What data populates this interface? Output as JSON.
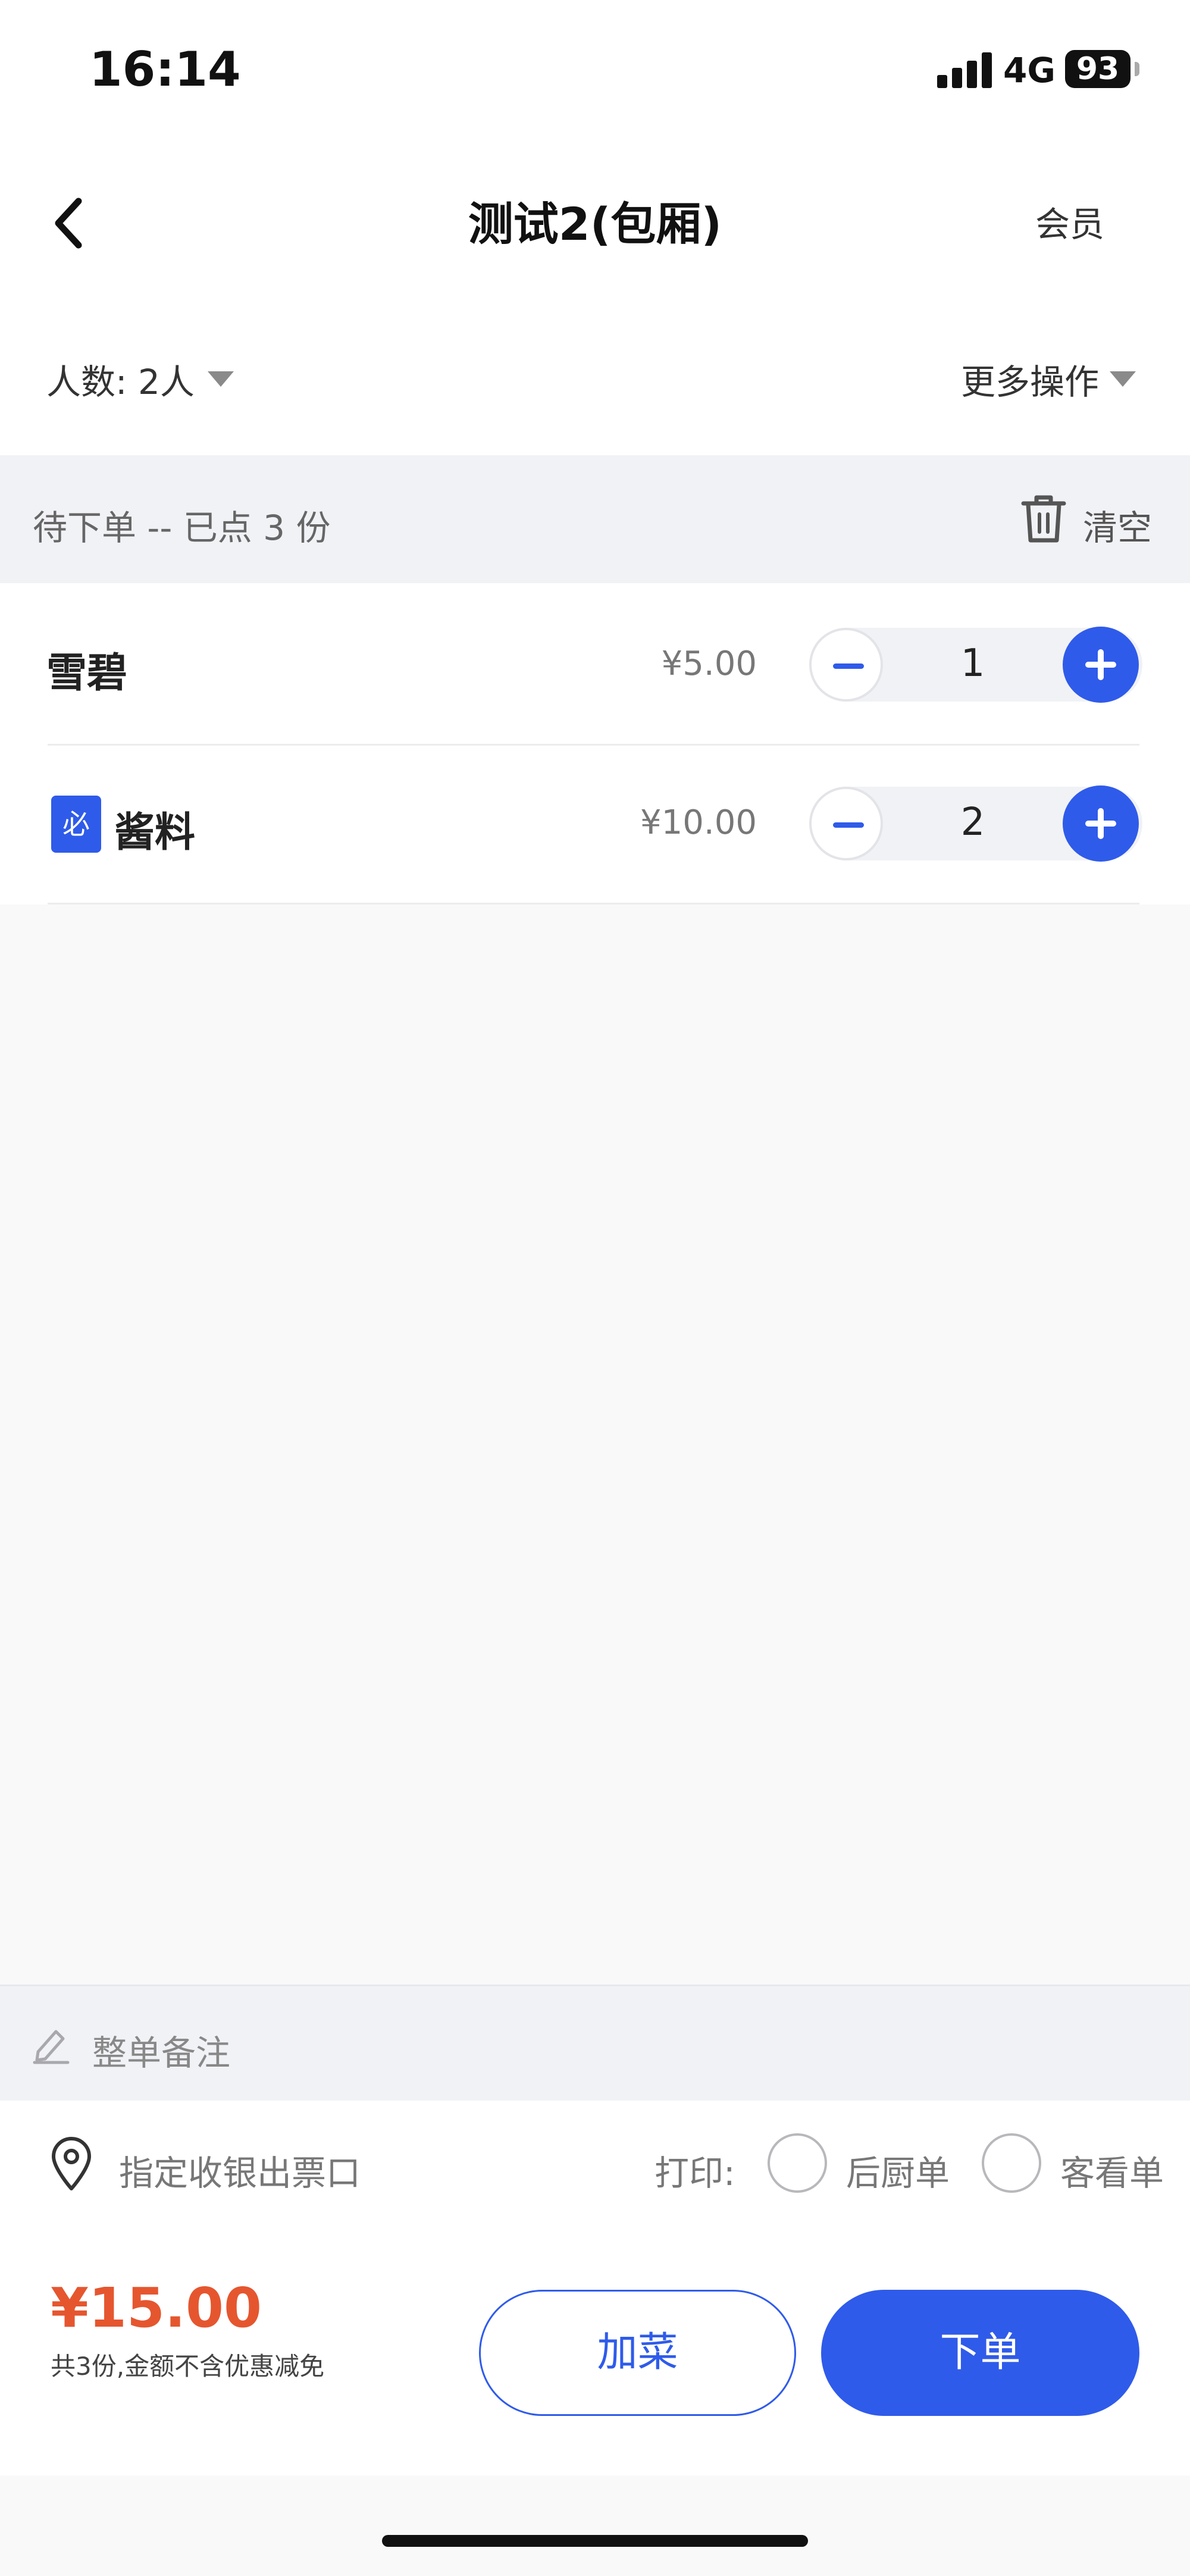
{
  "status_bar": {
    "time": "16:14",
    "network": "4G",
    "battery": "93"
  },
  "nav": {
    "title": "测试2(包厢)",
    "member": "会员"
  },
  "people": {
    "label": "人数: 2人",
    "more_actions": "更多操作"
  },
  "pending": {
    "summary": "待下单 -- 已点 3 份",
    "clear": "清空"
  },
  "items": [
    {
      "name": "雪碧",
      "price": "¥5.00",
      "qty": "1",
      "badge": ""
    },
    {
      "name": "酱料",
      "price": "¥10.00",
      "qty": "2",
      "badge": "必"
    }
  ],
  "remark": {
    "placeholder": "整单备注"
  },
  "cashier": {
    "label": "指定收银出票口"
  },
  "print": {
    "label": "打印:",
    "options": [
      "后厨单",
      "客看单"
    ]
  },
  "footer": {
    "total": "¥15.00",
    "note": "共3份,金额不含优惠减免",
    "add_dish": "加菜",
    "place_order": "下单"
  },
  "colors": {
    "accent": "#2f5bea",
    "price": "#e5562f"
  }
}
